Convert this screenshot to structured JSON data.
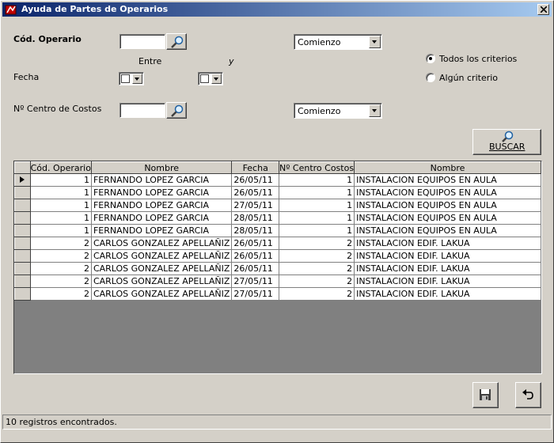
{
  "window": {
    "title": "Ayuda de Partes de Operarios",
    "close_glyph": "×"
  },
  "filters": {
    "operario_label": "Cód. Operario",
    "operario_value": "",
    "operario_match": "Comienzo",
    "entre_label": "Entre",
    "y_label": "y",
    "fecha_label": "Fecha",
    "centro_label": "Nº Centro de Costos",
    "centro_value": "",
    "centro_match": "Comienzo"
  },
  "criteria": {
    "all_label": "Todos los criterios",
    "any_label": "Algún criterio",
    "selected": "all"
  },
  "search_button_label": "BUSCAR",
  "grid": {
    "columns": [
      "Cód. Operario",
      "Nombre",
      "Fecha",
      "Nº Centro Costos",
      "Nombre"
    ],
    "rows": [
      [
        "1",
        "FERNANDO LOPEZ GARCIA",
        "26/05/11",
        "1",
        "INSTALACION EQUIPOS EN AULA"
      ],
      [
        "1",
        "FERNANDO LOPEZ GARCIA",
        "26/05/11",
        "1",
        "INSTALACION EQUIPOS EN AULA"
      ],
      [
        "1",
        "FERNANDO LOPEZ GARCIA",
        "27/05/11",
        "1",
        "INSTALACION EQUIPOS EN AULA"
      ],
      [
        "1",
        "FERNANDO LOPEZ GARCIA",
        "28/05/11",
        "1",
        "INSTALACION EQUIPOS EN AULA"
      ],
      [
        "1",
        "FERNANDO LOPEZ GARCIA",
        "28/05/11",
        "1",
        "INSTALACION EQUIPOS EN AULA"
      ],
      [
        "2",
        "CARLOS GONZALEZ APELLAÑIZ",
        "26/05/11",
        "2",
        "INSTALACION EDIF. LAKUA"
      ],
      [
        "2",
        "CARLOS GONZALEZ APELLAÑIZ",
        "26/05/11",
        "2",
        "INSTALACION EDIF. LAKUA"
      ],
      [
        "2",
        "CARLOS GONZALEZ APELLAÑIZ",
        "26/05/11",
        "2",
        "INSTALACION EDIF. LAKUA"
      ],
      [
        "2",
        "CARLOS GONZALEZ APELLAÑIZ",
        "27/05/11",
        "2",
        "INSTALACION EDIF. LAKUA"
      ],
      [
        "2",
        "CARLOS GONZALEZ APELLAÑIZ",
        "27/05/11",
        "2",
        "INSTALACION EDIF. LAKUA"
      ]
    ]
  },
  "status": {
    "text": "10 registros encontrados."
  },
  "icons": {
    "app": "app-icon",
    "search": "magnifier-icon",
    "save": "floppy-disk-icon",
    "undo": "undo-arrow-icon"
  },
  "colors": {
    "titlebar_start": "#0a246a",
    "titlebar_end": "#a6caf0",
    "face": "#d4d0c8",
    "grid_bg": "#808080"
  }
}
